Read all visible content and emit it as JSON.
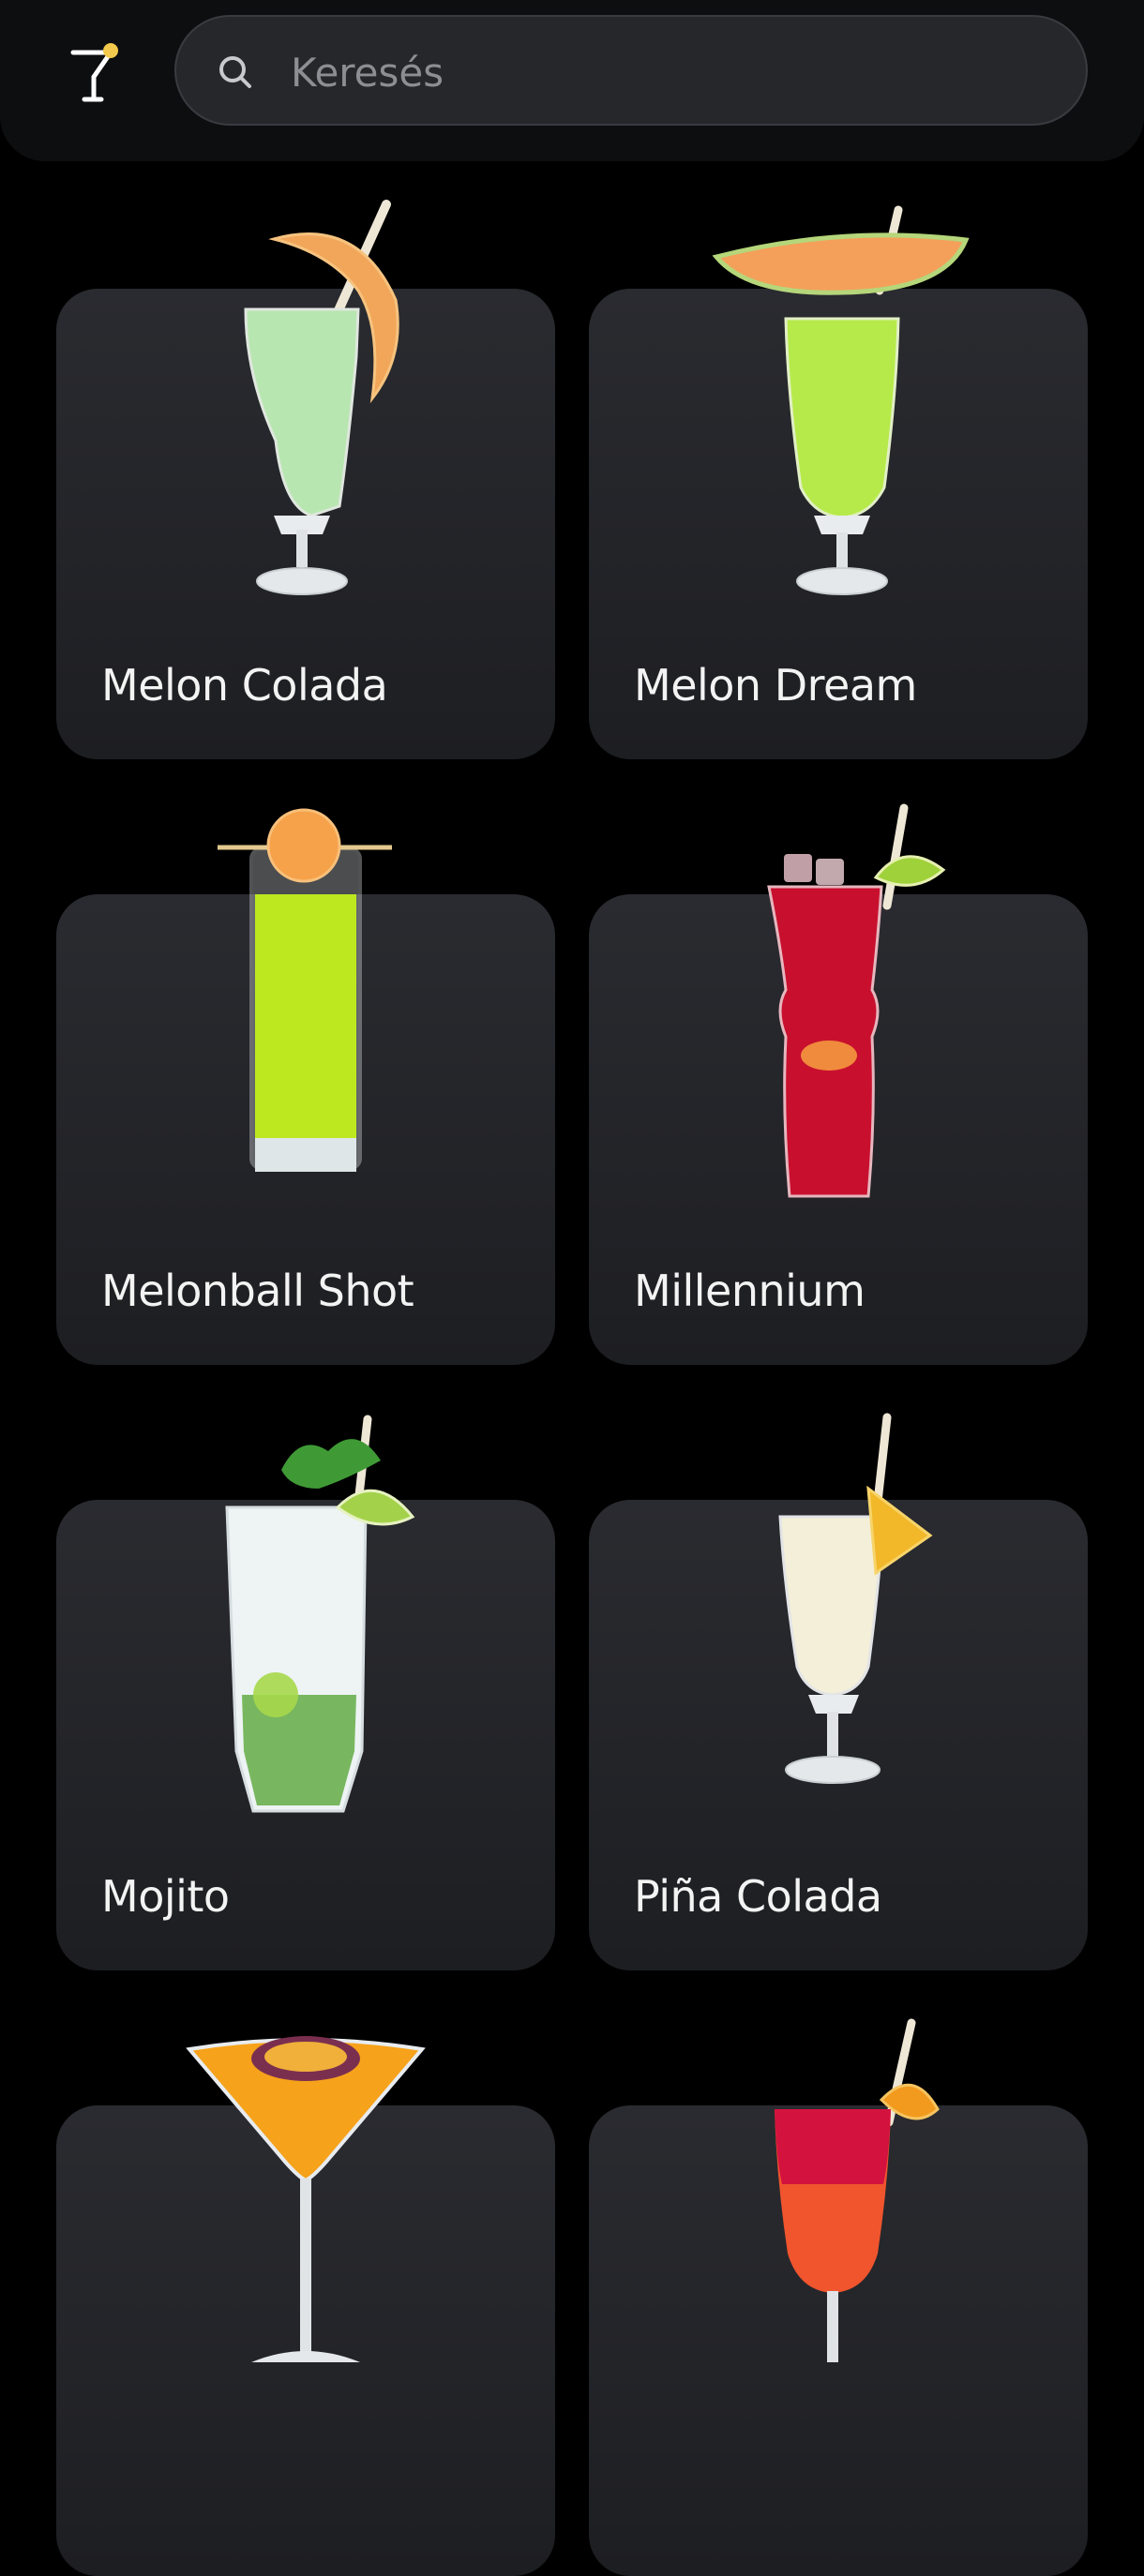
{
  "header": {
    "logo_icon": "cocktail-glass-icon",
    "search": {
      "placeholder": "Keresés",
      "icon": "search-icon"
    }
  },
  "colors": {
    "background": "#000000",
    "header": "#0d0e10",
    "card": "#26272b",
    "text": "#f3f3f3",
    "placeholder": "#8d8e93"
  },
  "cocktails": [
    {
      "name": "Melon Colada"
    },
    {
      "name": "Melon Dream"
    },
    {
      "name": "Melonball Shot"
    },
    {
      "name": "Millennium"
    },
    {
      "name": "Mojito"
    },
    {
      "name": "Piña Colada"
    },
    {
      "name": ""
    },
    {
      "name": ""
    }
  ]
}
